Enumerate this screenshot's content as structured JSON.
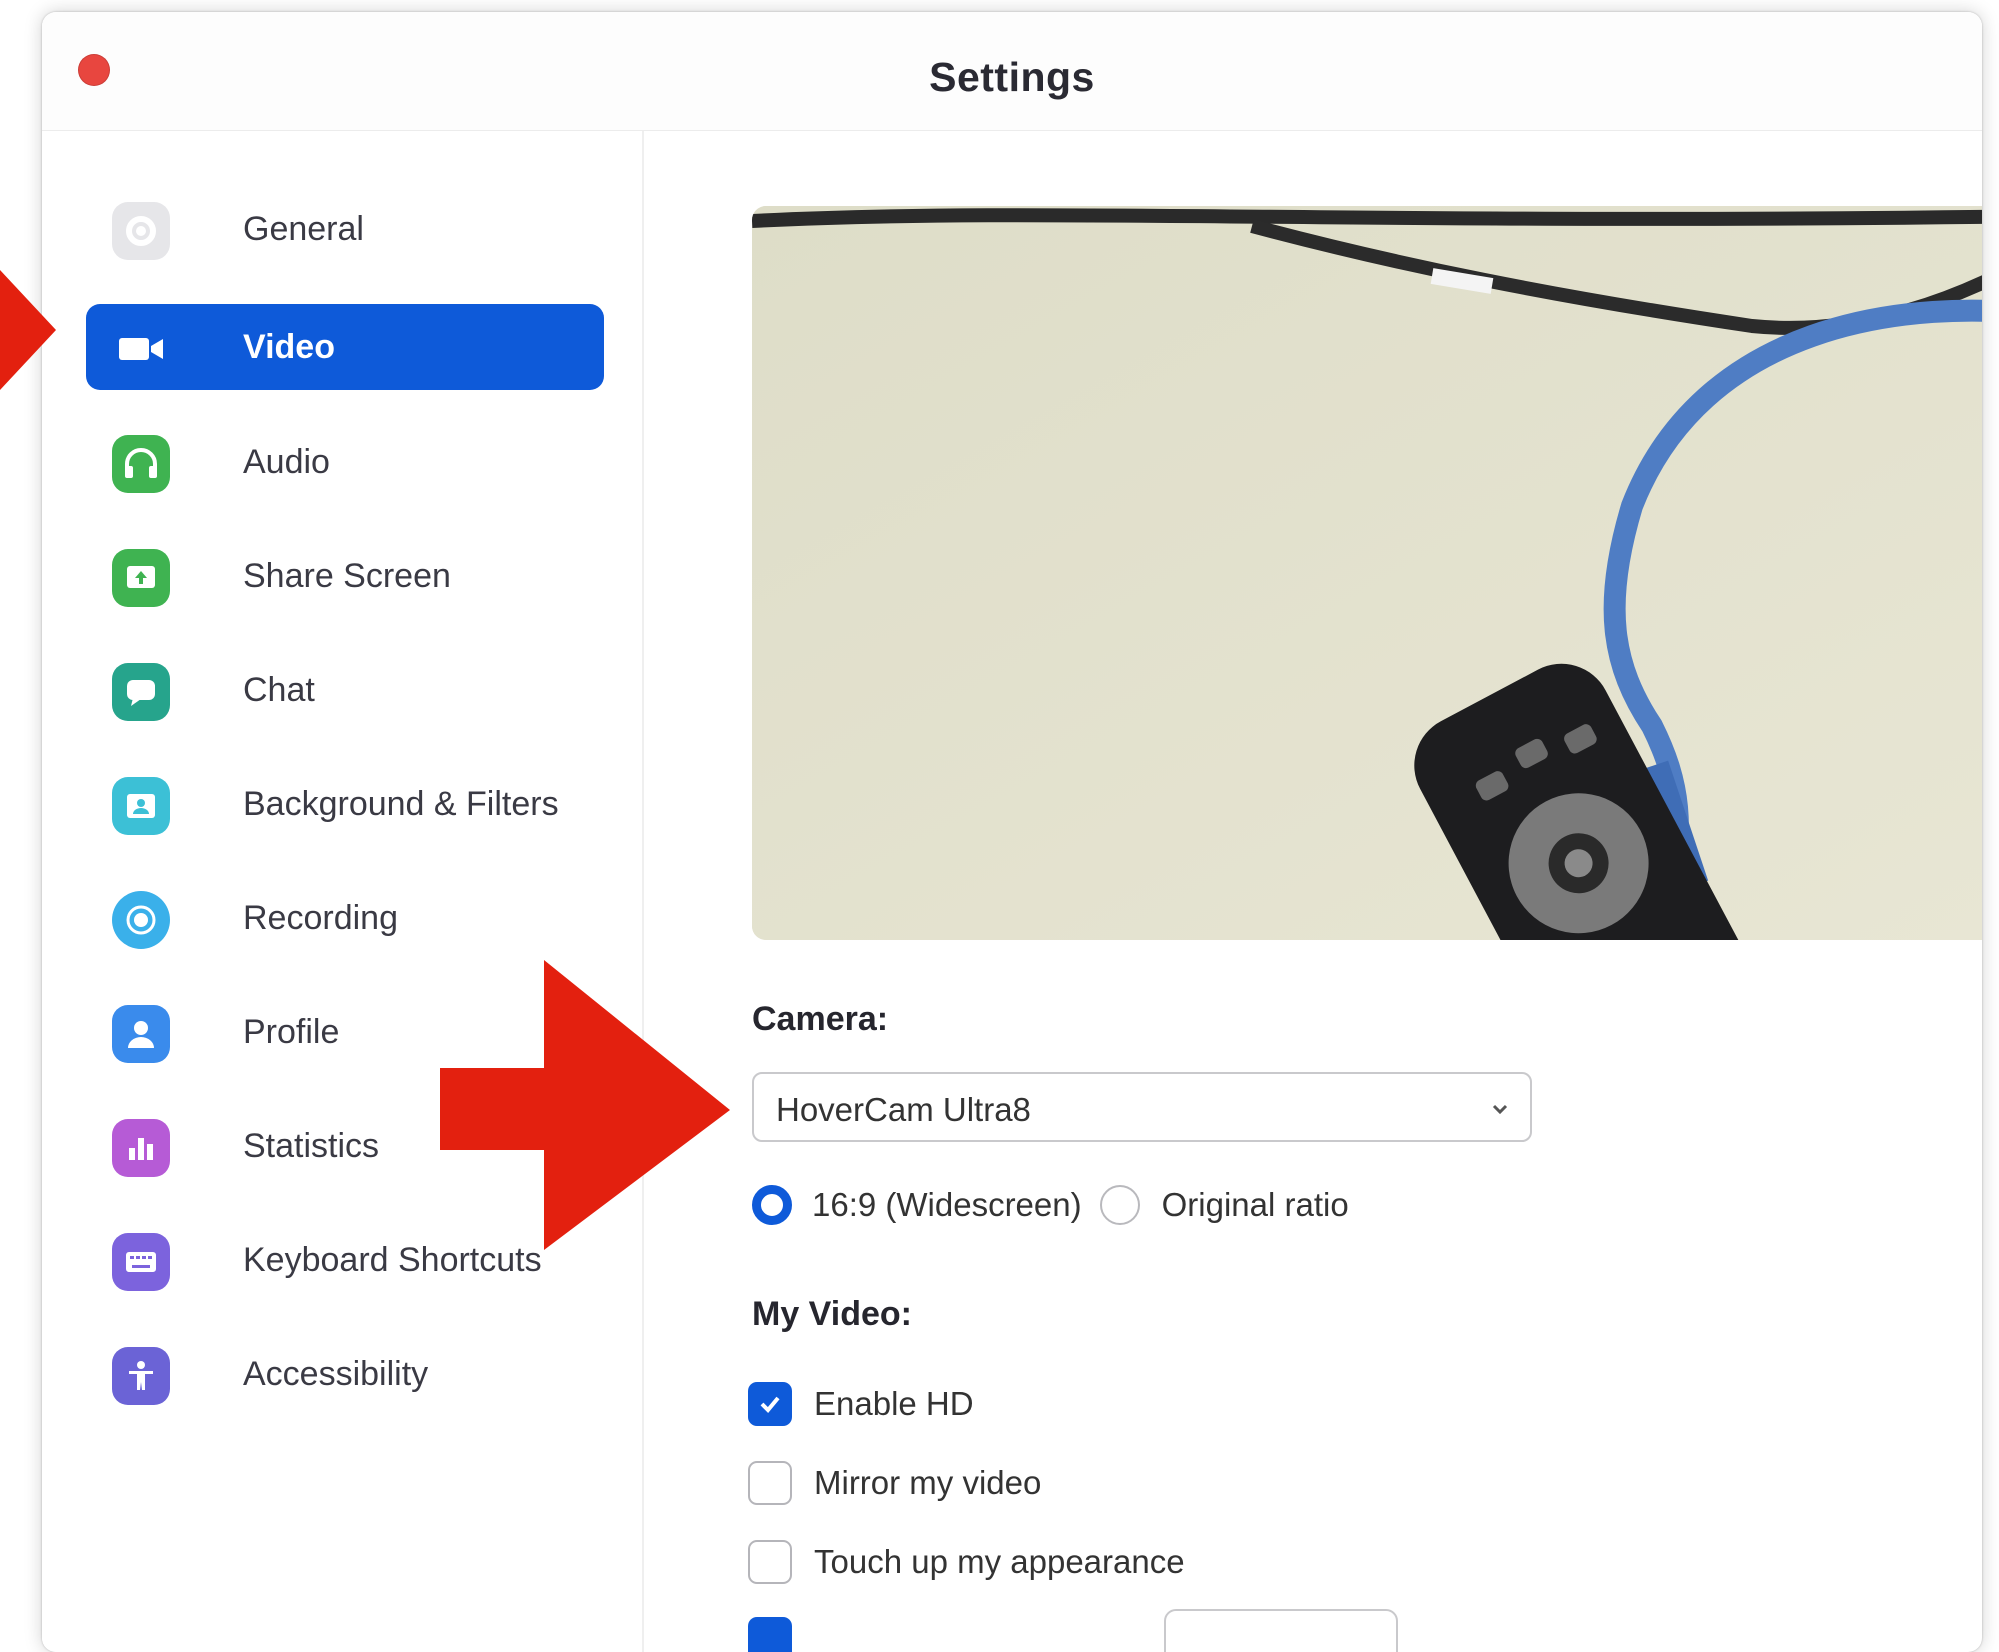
{
  "window": {
    "title": "Settings"
  },
  "sidebar": {
    "items": [
      {
        "label": "General",
        "icon": "gear-icon",
        "color": "#c8c8cc",
        "active": false
      },
      {
        "label": "Video",
        "icon": "video-camera-icon",
        "color": "#0e5ad9",
        "active": true
      },
      {
        "label": "Audio",
        "icon": "headphones-icon",
        "color": "#3fb351",
        "active": false
      },
      {
        "label": "Share Screen",
        "icon": "share-screen-icon",
        "color": "#3fb351",
        "active": false
      },
      {
        "label": "Chat",
        "icon": "chat-bubble-icon",
        "color": "#26a48c",
        "active": false
      },
      {
        "label": "Background & Filters",
        "icon": "background-person-icon",
        "color": "#3cc0d6",
        "active": false
      },
      {
        "label": "Recording",
        "icon": "record-icon",
        "color": "#3ab0ea",
        "active": false
      },
      {
        "label": "Profile",
        "icon": "person-icon",
        "color": "#3a8bec",
        "active": false
      },
      {
        "label": "Statistics",
        "icon": "bar-chart-icon",
        "color": "#b65bd6",
        "active": false
      },
      {
        "label": "Keyboard Shortcuts",
        "icon": "keyboard-icon",
        "color": "#7c63dd",
        "active": false
      },
      {
        "label": "Accessibility",
        "icon": "accessibility-person-icon",
        "color": "#6b63d6",
        "active": false
      }
    ]
  },
  "video": {
    "camera_label": "Camera:",
    "camera_value": "HoverCam Ultra8",
    "ratio_options": [
      {
        "label": "16:9 (Widescreen)",
        "selected": true
      },
      {
        "label": "Original ratio",
        "selected": false
      }
    ],
    "my_video_label": "My Video:",
    "checkboxes": [
      {
        "label": "Enable HD",
        "checked": true
      },
      {
        "label": "Mirror my video",
        "checked": false
      },
      {
        "label": "Touch up my appearance",
        "checked": false
      }
    ]
  },
  "colors": {
    "accent": "#0e5ad9",
    "annotation_arrow": "#e3200f"
  }
}
